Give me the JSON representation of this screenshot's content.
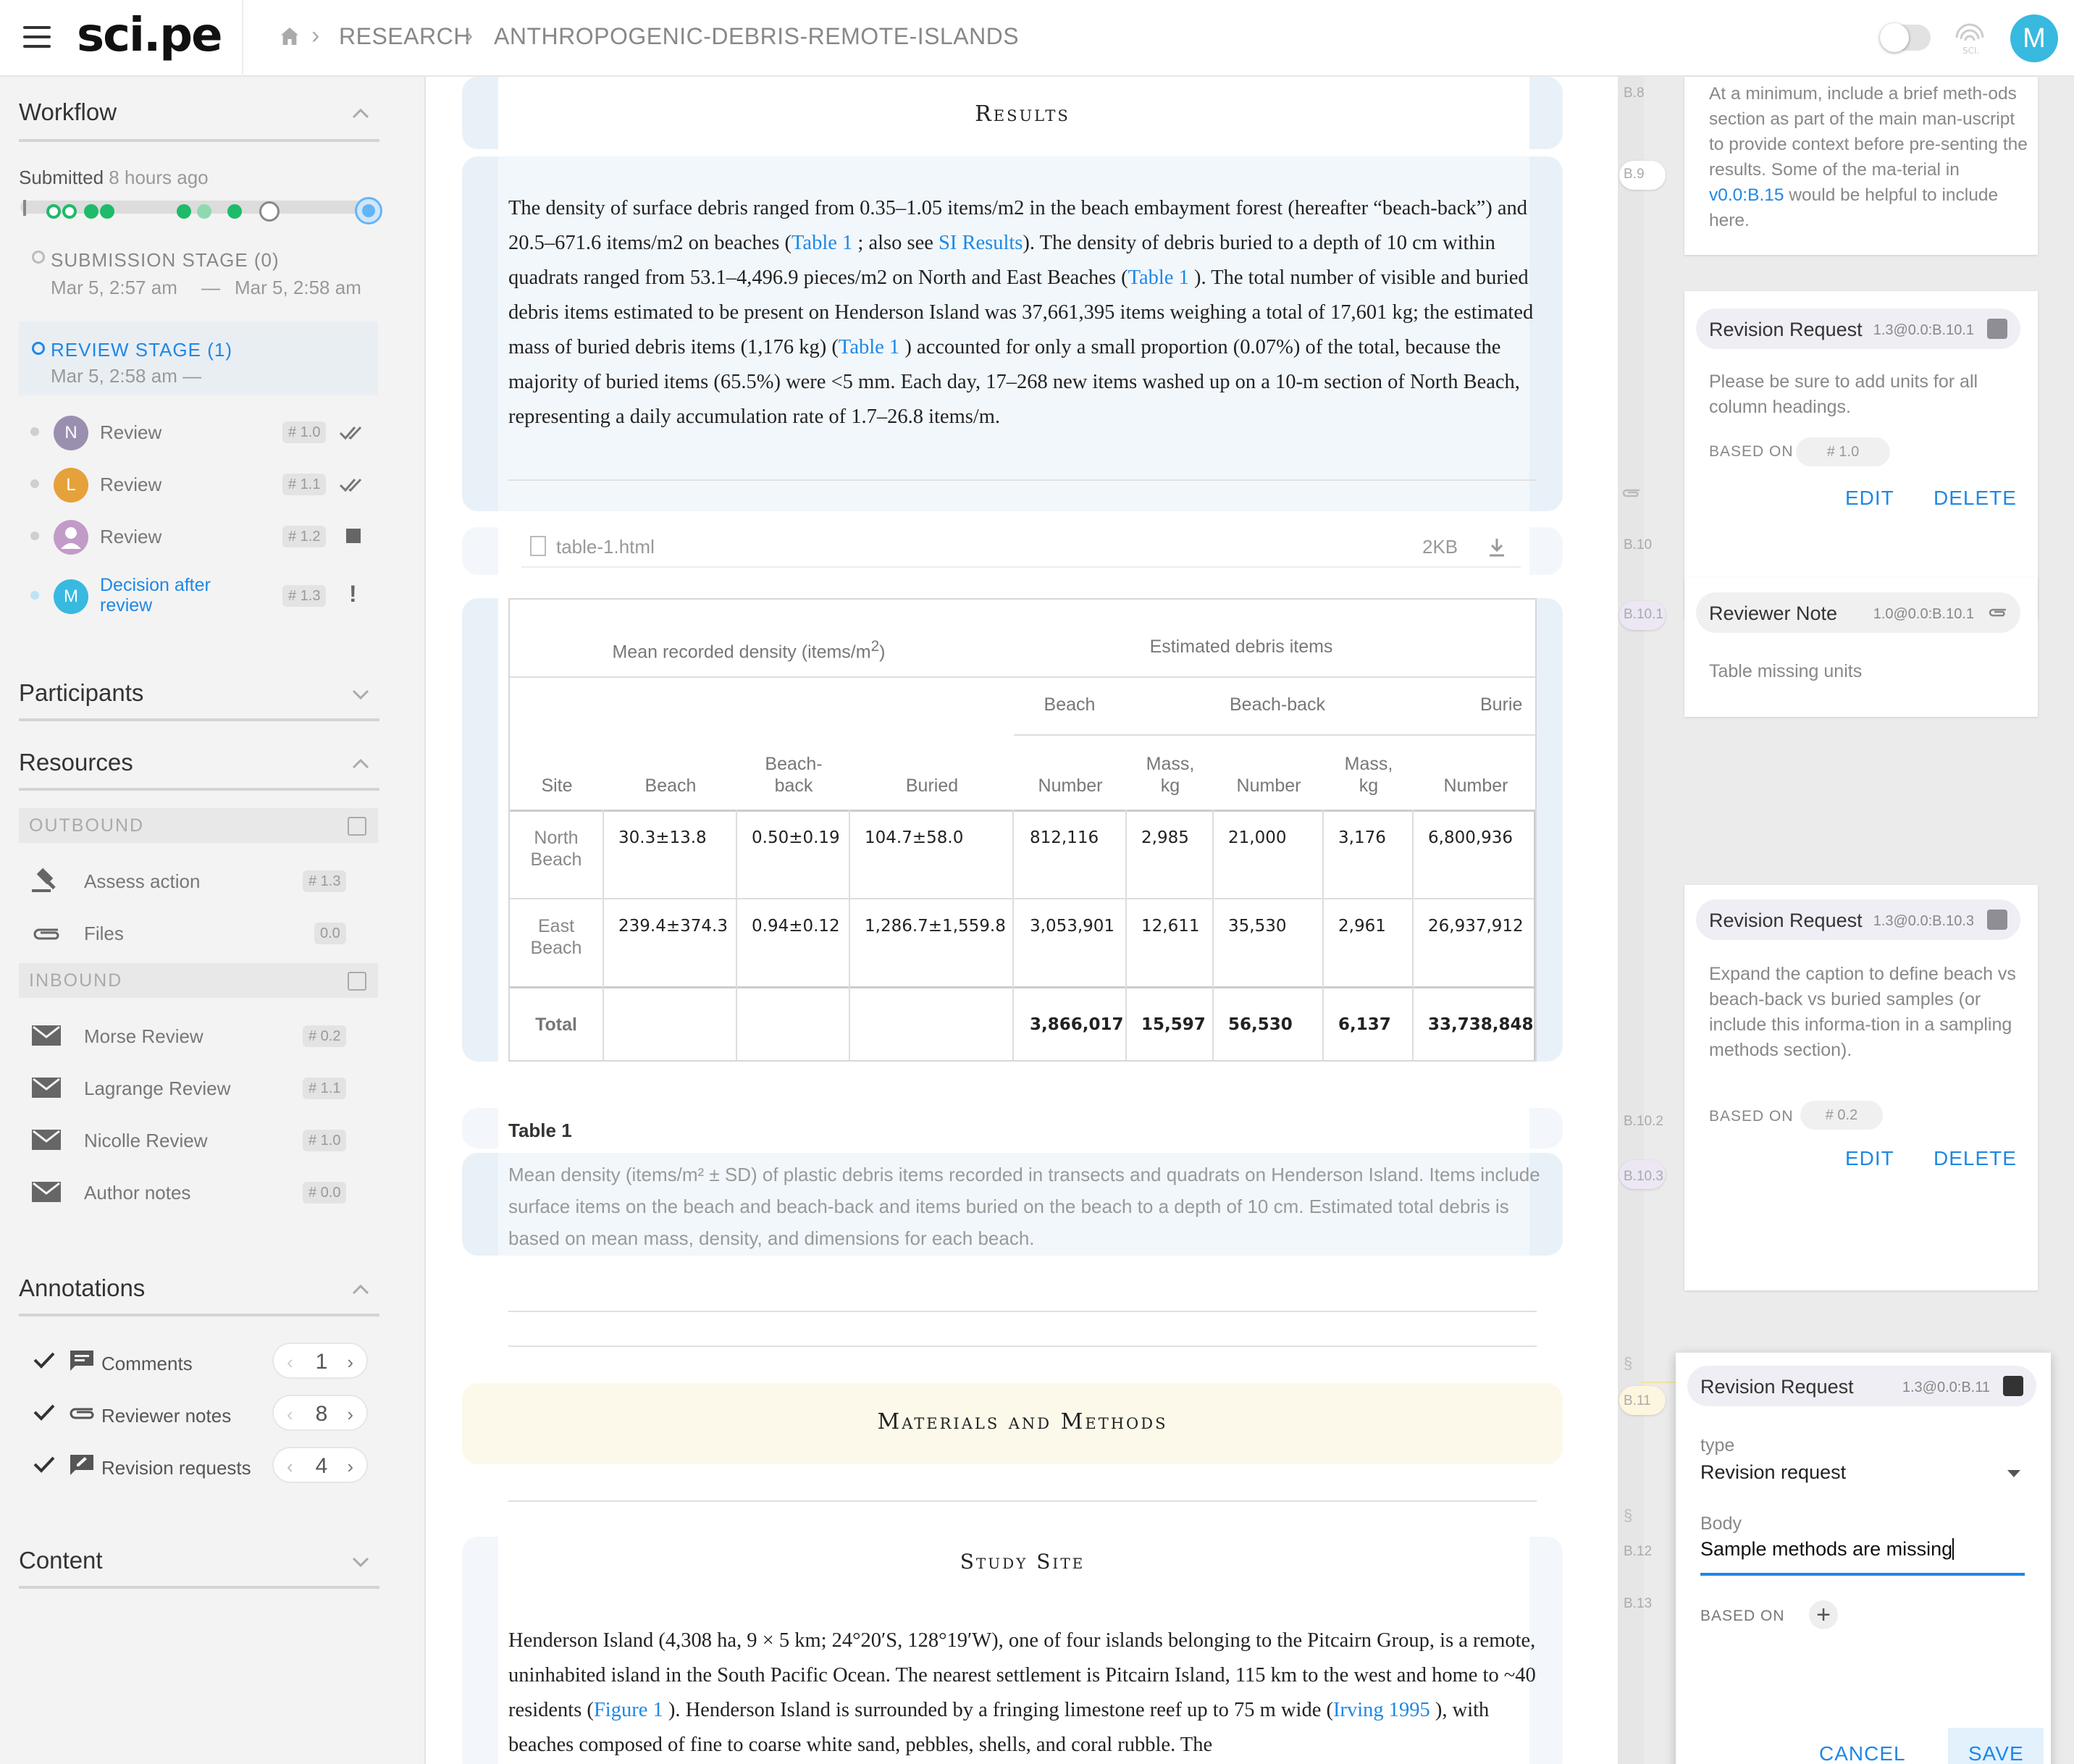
{
  "app": {
    "logo": "sci.pe",
    "breadcrumb": [
      "RESEARCH",
      "ANTHROPOGENIC-DEBRIS-REMOTE-ISLANDS"
    ],
    "avatar_initial": "M",
    "accent": "#1e88e5"
  },
  "sidebar": {
    "workflow": {
      "title": "Workflow",
      "submitted_label": "Submitted",
      "submitted_ago": " 8 hours ago"
    },
    "submission_stage": {
      "label": "SUBMISSION STAGE (0)",
      "start": "Mar 5, 2:57 am",
      "dash": "—",
      "end": "Mar 5, 2:58 am"
    },
    "review_stage": {
      "label": "REVIEW STAGE (1)",
      "dates": "Mar 5, 2:58 am —"
    },
    "reviews": [
      {
        "initial": "N",
        "label": "Review",
        "tag": "# 1.0",
        "color": "#9b8fb0"
      },
      {
        "initial": "L",
        "label": "Review",
        "tag": "# 1.1",
        "color": "#e5a13a"
      },
      {
        "initial": "",
        "label": "Review",
        "tag": "# 1.2",
        "color": "#c29bc9"
      },
      {
        "initial": "M",
        "label": "Decision after review",
        "label_l1": "Decision after",
        "label_l2": "review",
        "tag": "# 1.3",
        "color": "#38b9e0"
      }
    ],
    "participants_title": "Participants",
    "resources": {
      "title": "Resources",
      "outbound_label": "OUTBOUND",
      "outbound": [
        {
          "label": "Assess action",
          "tag": "# 1.3"
        },
        {
          "label": "Files",
          "tag": "0.0"
        }
      ],
      "inbound_label": "INBOUND",
      "inbound": [
        {
          "label": "Morse Review",
          "tag": "# 0.2"
        },
        {
          "label": "Lagrange Review",
          "tag": "# 1.1"
        },
        {
          "label": "Nicolle Review",
          "tag": "# 1.0"
        },
        {
          "label": "Author notes",
          "tag": "# 0.0"
        }
      ]
    },
    "annotations": {
      "title": "Annotations",
      "items": [
        {
          "label": "Comments",
          "count": "1"
        },
        {
          "label": "Reviewer notes",
          "count": "8"
        },
        {
          "label": "Revision requests",
          "count": "4"
        }
      ]
    },
    "content_title": "Content"
  },
  "doc": {
    "results_heading": "Results",
    "results_para": {
      "p1": "The density of surface debris ranged from 0.35–1.05 items/m2 in the beach embayment forest (hereafter “beach-back”) and 20.5–671.6 items/m2 on beaches (",
      "l1": "Table 1",
      "p2": " ; also see ",
      "l2": "SI Results",
      "p3": "). The density of debris buried to a depth of 10 cm within quadrats ranged from 53.1–4,496.9 pieces/m2 on North and East Beaches (",
      "l3": "Table 1",
      "p4": " ). The total number of visible and buried debris items estimated to be present on Henderson Island was 37,661,395 items weighing a total of 17,601 kg; the estimated mass of buried debris items (1,176 kg) (",
      "l4": "Table 1",
      "p5": " ) accounted for only a small proportion (0.07%) of the total, because the majority of buried items (65.5%) were <5 mm. Each day, 17–268 new items washed up on a 10-m section of North Beach, representing a daily accumulation rate of 1.7–26.8 items/m."
    },
    "file": {
      "name": "table-1.html",
      "size": "2KB"
    },
    "table": {
      "group1": "Mean recorded density (items/m",
      "group1_sup": "2",
      "group1_end": ")",
      "group2": "Estimated debris items",
      "sub_beach": "Beach",
      "sub_beachback": "Beach-back",
      "sub_buried": "Burie",
      "cols": [
        "Site",
        "Beach",
        "Beach-back",
        "Buried",
        "Number",
        "Mass, kg",
        "Number",
        "Mass, kg",
        "Number"
      ],
      "rows": [
        [
          "North Beach",
          "30.3±13.8",
          "0.50±0.19",
          "104.7±58.0",
          "812,116",
          "2,985",
          "21,000",
          "3,176",
          "6,800,936"
        ],
        [
          "East Beach",
          "239.4±374.3",
          "0.94±0.12",
          "1,286.7±1,559.8",
          "3,053,901",
          "12,611",
          "35,530",
          "2,961",
          "26,937,912"
        ],
        [
          "Total",
          "",
          "",
          "",
          "3,866,017",
          "15,597",
          "56,530",
          "6,137",
          "33,738,848"
        ]
      ]
    },
    "caption_title": "Table 1",
    "caption_text": "Mean density (items/m² ± SD) of plastic debris items recorded in transects and quadrats on Henderson Island. Items include surface items on the beach and beach-back and items buried on the beach to a depth of 10 cm. Estimated total debris is based on mean mass, density, and dimensions for each beach.",
    "methods_heading": "Materials and Methods",
    "study_heading": "Study Site",
    "study_para": {
      "p1": "Henderson Island (4,308 ha, 9 × 5 km; 24°20′S, 128°19′W), one of four islands belonging to the Pitcairn Group, is a remote, uninhabited island in the South Pacific Ocean. The nearest settlement is Pitcairn Island, 115 km to the west and home to ~40 residents (",
      "l1": "Figure 1",
      "p2": " ). Henderson Island is surrounded by a fringing limestone reef up to 75 m wide (",
      "l2": "Irving 1995",
      "p3": " ), with beaches composed of fine to coarse white sand, pebbles, shells, and coral rubble. The"
    }
  },
  "gutter_labels": [
    "B.8",
    "B.9",
    "B.10",
    "B.10.1",
    "B.10.2",
    "B.10.3",
    "B.11",
    "B.12",
    "B.13"
  ],
  "panel": {
    "note_top": {
      "text1": "At a minimum, include a brief meth-ods section as part of the main man-uscript to provide context before pre-senting the results. Some of the ma-terial in ",
      "link": "v0.0:B.15",
      "text2": " would be helpful to include here."
    },
    "card1": {
      "title": "Revision Request",
      "ref": "1.3@0.0:B.10.1",
      "body": "Please be sure to add units for all column headings.",
      "based_on": "BASED ON",
      "based_tag": "# 1.0",
      "edit": "EDIT",
      "delete": "DELETE"
    },
    "card2": {
      "title": "Reviewer Note",
      "ref": "1.0@0.0:B.10.1",
      "body": "Table missing units"
    },
    "card3": {
      "title": "Revision Request",
      "ref": "1.3@0.0:B.10.3",
      "body": "Expand the caption to define beach vs beach-back vs buried samples (or include this informa-tion in a sampling methods section).",
      "based_on": "BASED ON",
      "based_tag": "# 0.2",
      "edit": "EDIT",
      "delete": "DELETE"
    },
    "card4": {
      "title": "Revision Request",
      "ref": "1.3@0.0:B.11",
      "type_label": "type",
      "type_value": "Revision request",
      "body_label": "Body",
      "body_value": "Sample methods are missing",
      "based_on": "BASED ON",
      "cancel": "CANCEL",
      "save": "SAVE"
    }
  }
}
